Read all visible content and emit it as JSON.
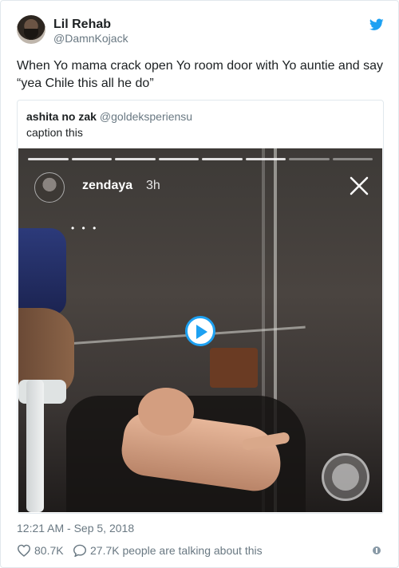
{
  "tweet": {
    "author_name": "Lil Rehab",
    "author_handle": "@DamnKojack",
    "text": "When Yo mama crack open Yo room door with Yo auntie and say “yea Chile this all he do”",
    "timestamp": "12:21 AM - Sep 5, 2018",
    "likes": "80.7K",
    "replies_summary": "27.7K people are talking about this"
  },
  "quoted": {
    "author_name": "ashita no zak",
    "author_handle": "@goldeksperiensu",
    "text": "caption this",
    "story": {
      "username": "zendaya",
      "time": "3h",
      "dots": "• • •"
    }
  },
  "colors": {
    "accent": "#1da1f2",
    "muted": "#697882",
    "border": "#e1e8ed"
  },
  "icons": {
    "bird": "twitter-bird-icon",
    "heart": "heart-icon",
    "reply": "speech-bubble-icon",
    "info": "info-icon",
    "play": "play-icon",
    "close": "close-icon"
  }
}
